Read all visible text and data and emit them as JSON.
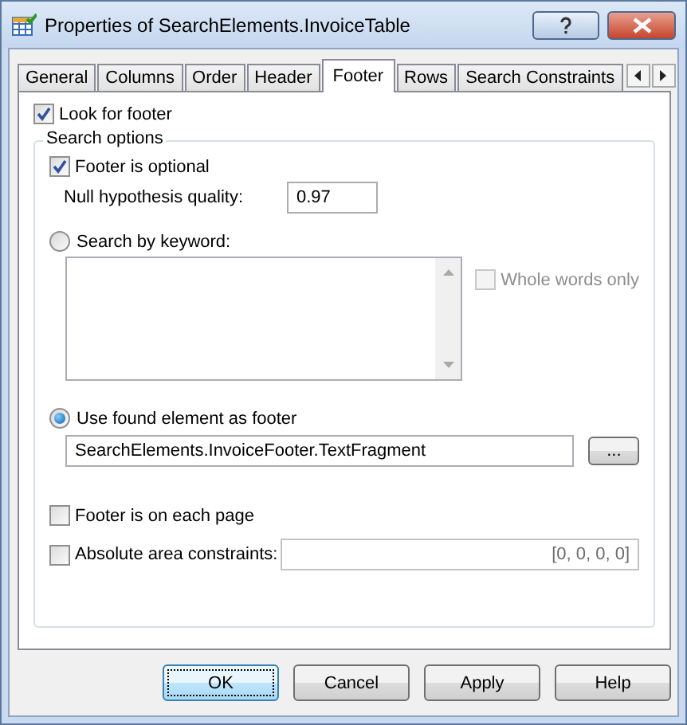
{
  "window": {
    "title": "Properties of SearchElements.InvoiceTable"
  },
  "tabs": [
    {
      "label": "General",
      "selected": false
    },
    {
      "label": "Columns",
      "selected": false
    },
    {
      "label": "Order",
      "selected": false
    },
    {
      "label": "Header",
      "selected": false
    },
    {
      "label": "Footer",
      "selected": true
    },
    {
      "label": "Rows",
      "selected": false
    },
    {
      "label": "Search Constraints",
      "selected": false
    }
  ],
  "look_for_footer": {
    "label": "Look for footer",
    "checked": true
  },
  "search_options": {
    "title": "Search options",
    "footer_optional": {
      "label": "Footer is optional",
      "checked": true
    },
    "null_quality": {
      "label": "Null hypothesis quality:",
      "value": "0.97"
    },
    "search_by_keyword": {
      "label": "Search by keyword:",
      "selected": false
    },
    "whole_words": {
      "label": "Whole words only",
      "checked": false,
      "disabled": true
    },
    "use_found": {
      "label": "Use found element as footer",
      "selected": true
    },
    "found_element": {
      "value": "SearchElements.InvoiceFooter.TextFragment"
    },
    "browse_button": "...",
    "footer_each_page": {
      "label": "Footer is on each page",
      "checked": false
    },
    "absolute": {
      "label": "Absolute area constraints:",
      "checked": false,
      "value": "[0, 0, 0, 0]"
    }
  },
  "buttons": [
    {
      "label": "OK",
      "default": true
    },
    {
      "label": "Cancel",
      "default": false
    },
    {
      "label": "Apply",
      "default": false
    },
    {
      "label": "Help",
      "default": false
    }
  ]
}
